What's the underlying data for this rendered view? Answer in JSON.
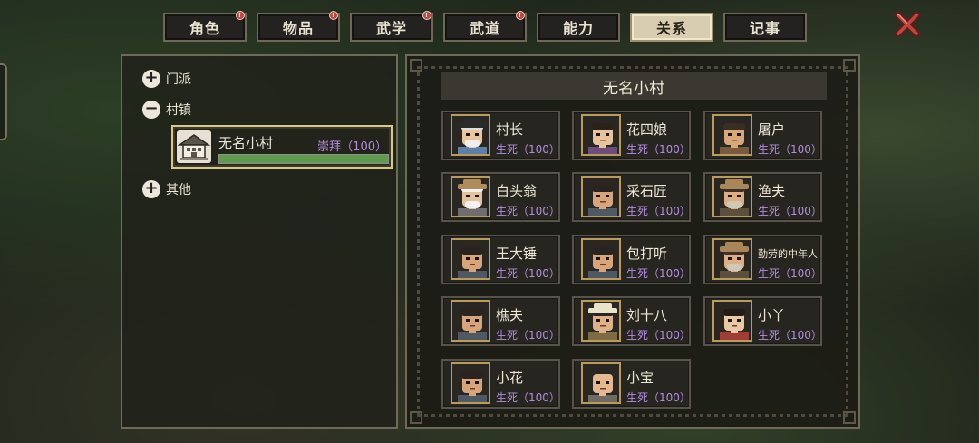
{
  "tabs": [
    {
      "label": "角色",
      "badge": true,
      "active": false
    },
    {
      "label": "物品",
      "badge": true,
      "active": false
    },
    {
      "label": "武学",
      "badge": true,
      "active": false
    },
    {
      "label": "武道",
      "badge": true,
      "active": false
    },
    {
      "label": "能力",
      "badge": false,
      "active": false
    },
    {
      "label": "关系",
      "badge": false,
      "active": true
    },
    {
      "label": "记事",
      "badge": false,
      "active": false
    }
  ],
  "close_icon": "close-x-icon",
  "tree": {
    "group1": {
      "toggle": "+",
      "label": "门派"
    },
    "group2": {
      "toggle": "−",
      "label": "村镇"
    },
    "group3": {
      "toggle": "+",
      "label": "其他"
    },
    "village": {
      "name": "无名小村",
      "relation": "崇拜（100）",
      "progress_fraction": 1.0,
      "icon": "village-house-icon"
    }
  },
  "panel_title": "无名小村",
  "characters": [
    {
      "name": "村长",
      "relation": "生死（100）",
      "look": "elder"
    },
    {
      "name": "花四娘",
      "relation": "生死（100）",
      "look": "woman"
    },
    {
      "name": "屠户",
      "relation": "生死（100）",
      "look": "bald"
    },
    {
      "name": "白头翁",
      "relation": "生死（100）",
      "look": "white"
    },
    {
      "name": "采石匠",
      "relation": "生死（100）",
      "look": "worker"
    },
    {
      "name": "渔夫",
      "relation": "生死（100）",
      "look": "hat"
    },
    {
      "name": "王大锤",
      "relation": "生死（100）",
      "look": "worker"
    },
    {
      "name": "包打听",
      "relation": "生死（100）",
      "look": "worker"
    },
    {
      "name": "勤劳的中年人",
      "relation": "生死（100）",
      "look": "hat"
    },
    {
      "name": "樵夫",
      "relation": "生死（100）",
      "look": "worker"
    },
    {
      "name": "刘十八",
      "relation": "生死（100）",
      "look": "bandana"
    },
    {
      "name": "小丫",
      "relation": "生死（100）",
      "look": "girl"
    },
    {
      "name": "小花",
      "relation": "生死（100）",
      "look": "worker"
    },
    {
      "name": "小宝",
      "relation": "生死（100）",
      "look": "baby"
    }
  ],
  "colors": {
    "relation_text": "#b48ce0",
    "progress_fill": "#5f9b4c",
    "badge": "#c0443a"
  }
}
